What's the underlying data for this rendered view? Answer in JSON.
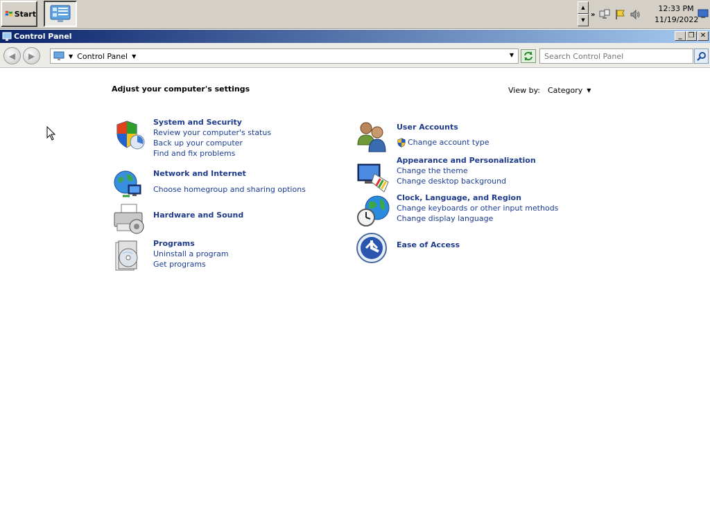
{
  "taskbar": {
    "start_label": "Start",
    "task_label": "Control Panel",
    "clock_time": "12:33 PM",
    "clock_date": "11/19/2022"
  },
  "window": {
    "title": "Control Panel",
    "minimize_label": "_",
    "maximize_label": "❐",
    "close_label": "✕"
  },
  "address": {
    "path": "Control Panel",
    "search_placeholder": "Search Control Panel"
  },
  "content": {
    "heading": "Adjust your computer's settings",
    "view_by_label": "View by:",
    "view_by_value": "Category",
    "left": [
      {
        "title": "System and Security",
        "links": [
          "Review your computer's status",
          "Back up your computer",
          "Find and fix problems"
        ]
      },
      {
        "title": "Network and Internet",
        "links": [
          "Choose homegroup and sharing options"
        ]
      },
      {
        "title": "Hardware and Sound",
        "links": []
      },
      {
        "title": "Programs",
        "links": [
          "Uninstall a program",
          "Get programs"
        ]
      }
    ],
    "right": [
      {
        "title": "User Accounts",
        "links": [
          "Change account type"
        ]
      },
      {
        "title": "Appearance and Personalization",
        "links": [
          "Change the theme",
          "Change desktop background"
        ]
      },
      {
        "title": "Clock, Language, and Region",
        "links": [
          "Change keyboards or other input methods",
          "Change display language"
        ]
      },
      {
        "title": "Ease of Access",
        "links": []
      }
    ]
  }
}
